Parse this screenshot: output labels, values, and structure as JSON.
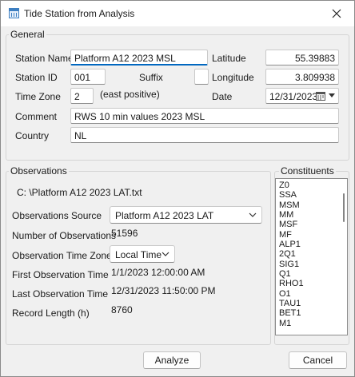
{
  "window": {
    "title": "Tide Station from Analysis"
  },
  "general": {
    "group_title": "General",
    "station_name": {
      "label": "Station Name",
      "value": "Platform A12 2023 MSL"
    },
    "station_id": {
      "label": "Station ID",
      "value": "001"
    },
    "suffix": {
      "label": "Suffix",
      "value": ""
    },
    "time_zone": {
      "label": "Time Zone",
      "value": "2",
      "hint": "(east positive)"
    },
    "comment": {
      "label": "Comment",
      "value": "RWS 10 min values 2023 MSL"
    },
    "country": {
      "label": "Country",
      "value": "NL"
    },
    "latitude": {
      "label": "Latitude",
      "value": "55.39883"
    },
    "longitude": {
      "label": "Longitude",
      "value": "3.809938"
    },
    "date": {
      "label": "Date",
      "value": "12/31/2023"
    }
  },
  "observations": {
    "group_title": "Observations",
    "file_path": "C: \\Platform A12 2023 LAT.txt",
    "source": {
      "label": "Observations Source",
      "value": "Platform A12 2023 LAT"
    },
    "count": {
      "label": "Number of Observations",
      "value": "51596"
    },
    "time_zone": {
      "label": "Observation Time Zone",
      "value": "Local Time"
    },
    "first_time": {
      "label": "First Observation Time",
      "value": "1/1/2023 12:00:00 AM"
    },
    "last_time": {
      "label": "Last Observation Time",
      "value": "12/31/2023 11:50:00 PM"
    },
    "record_length": {
      "label": "Record Length (h)",
      "value": "8760"
    }
  },
  "constituents": {
    "group_title": "Constituents",
    "items": [
      "Z0",
      "SSA",
      "MSM",
      "MM",
      "MSF",
      "MF",
      "ALP1",
      "2Q1",
      "SIG1",
      "Q1",
      "RHO1",
      "O1",
      "TAU1",
      "BET1",
      "M1"
    ]
  },
  "buttons": {
    "analyze": "Analyze",
    "cancel": "Cancel"
  }
}
